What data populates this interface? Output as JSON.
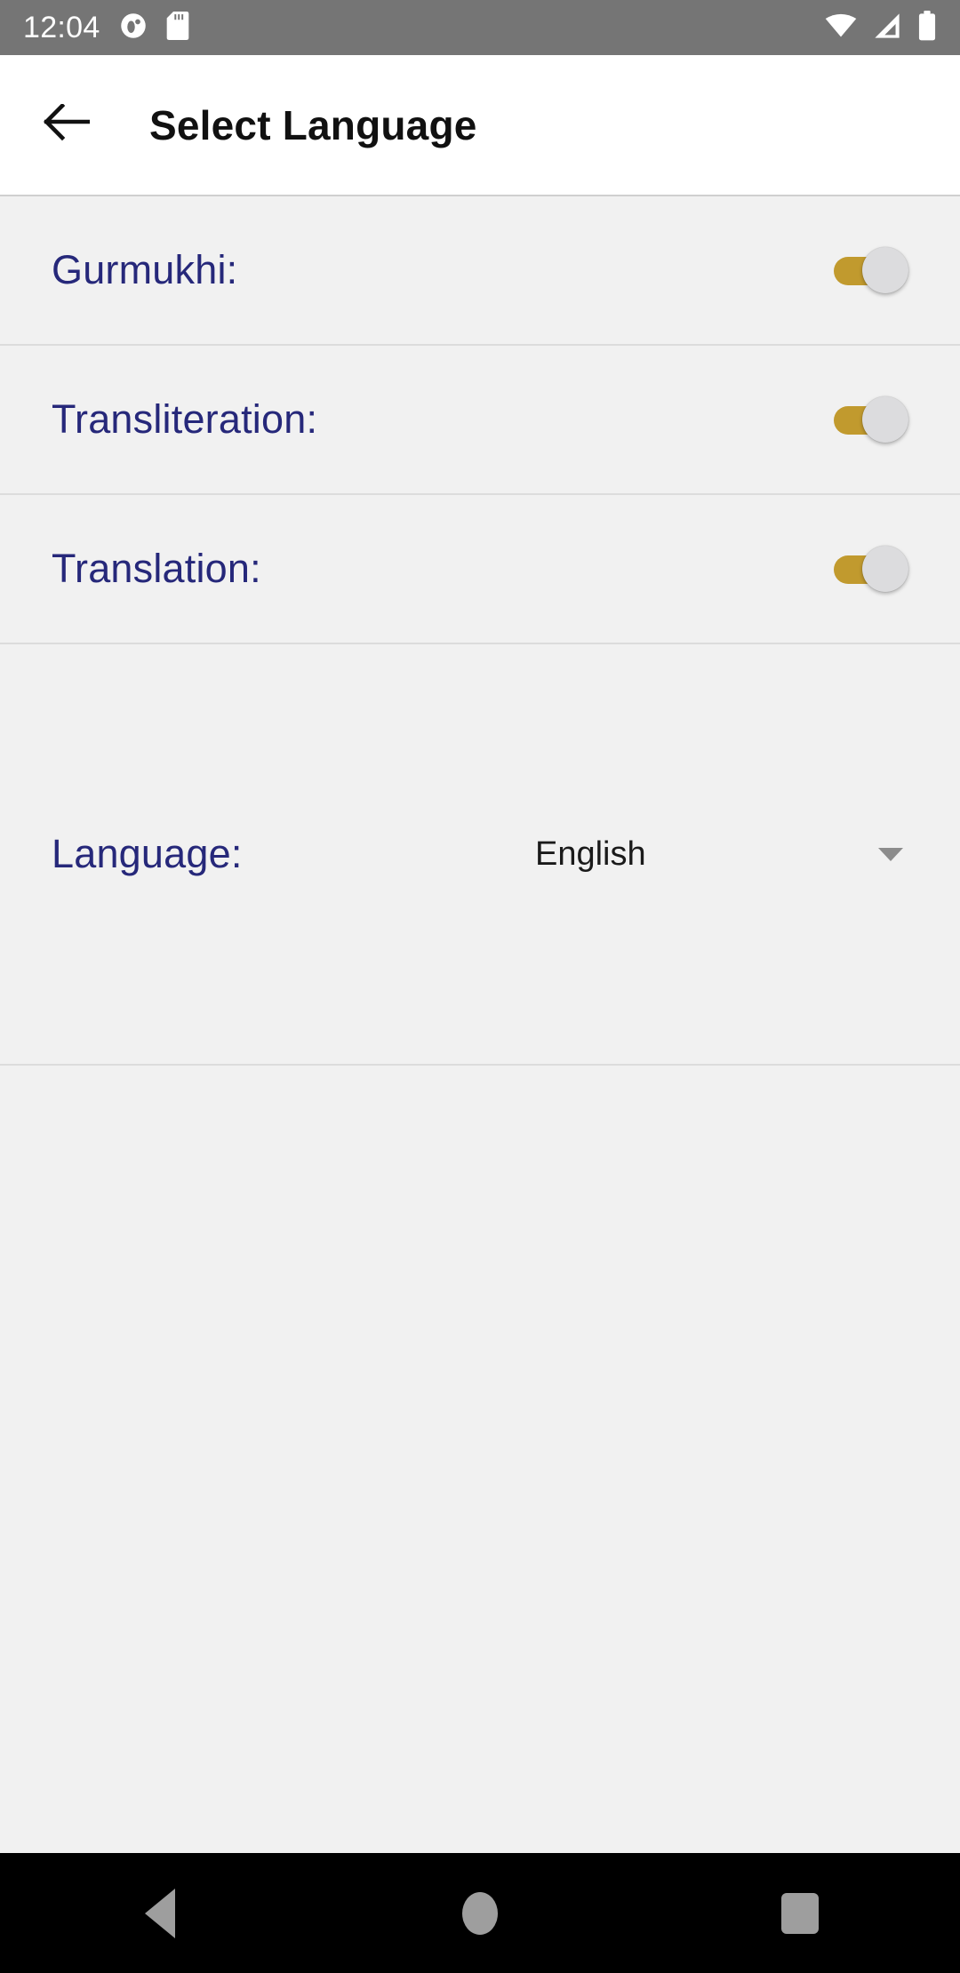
{
  "status_bar": {
    "time": "12:04",
    "left_icons": [
      {
        "name": "app-notification-icon",
        "glyph": "circle-dot"
      },
      {
        "name": "sd-card-icon",
        "glyph": "sd-card"
      }
    ],
    "right_icons": [
      {
        "name": "wifi-icon",
        "glyph": "wifi-full"
      },
      {
        "name": "cellular-signal-icon",
        "glyph": "signal-partial"
      },
      {
        "name": "battery-icon",
        "glyph": "battery-full"
      }
    ],
    "background_color": "#757575",
    "icon_color": "#FFFFFF"
  },
  "app_bar": {
    "title": "Select Language",
    "back_label": "Back",
    "background_color": "#FFFFFF",
    "title_color": "#111111"
  },
  "theme": {
    "page_background": "#F1F1F1",
    "label_color": "#26287A",
    "switch_track_on": "#C19A2E",
    "switch_thumb": "#DCDCDE",
    "divider": "#DCDCDC",
    "nav_bar_background": "#000000",
    "nav_icon_color": "#9E9E9E"
  },
  "settings": {
    "toggles": [
      {
        "key": "gurmukhi",
        "label": "Gurmukhi:",
        "enabled": true,
        "state_text": "On"
      },
      {
        "key": "transliteration",
        "label": "Transliteration:",
        "enabled": true,
        "state_text": "On"
      },
      {
        "key": "translation",
        "label": "Translation:",
        "enabled": true,
        "state_text": "On"
      }
    ],
    "language": {
      "label": "Language:",
      "selected": "English",
      "options": [
        "English"
      ]
    }
  },
  "nav_bar": {
    "buttons": [
      {
        "name": "nav-back-button",
        "label": "Back"
      },
      {
        "name": "nav-home-button",
        "label": "Home"
      },
      {
        "name": "nav-recents-button",
        "label": "Recents"
      }
    ]
  }
}
